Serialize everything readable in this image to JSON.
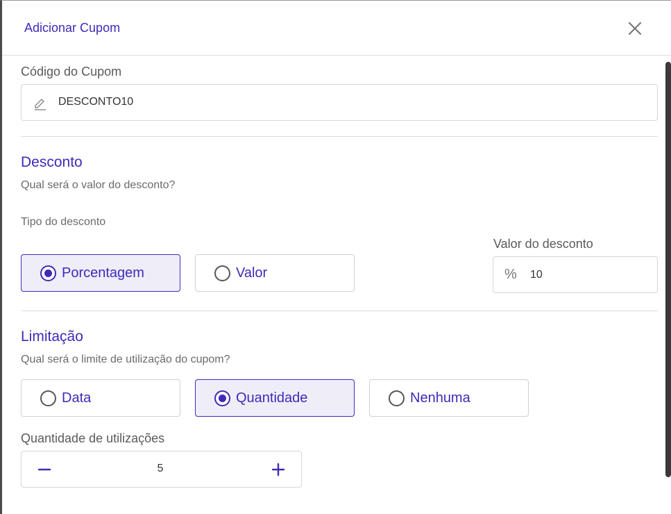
{
  "modal": {
    "title": "Adicionar Cupom",
    "close_icon": "close-icon"
  },
  "coupon_code": {
    "label": "Código do Cupom",
    "value": "DESCONTO10",
    "icon": "edit-pencil-icon"
  },
  "discount": {
    "title": "Desconto",
    "subtitle": "Qual será o valor do desconto?",
    "type_label": "Tipo do desconto",
    "options": [
      {
        "label": "Porcentagem",
        "selected": true
      },
      {
        "label": "Valor",
        "selected": false
      }
    ],
    "value_label": "Valor do desconto",
    "value_icon": "percent-icon",
    "value_symbol": "%",
    "value": "10"
  },
  "limitation": {
    "title": "Limitação",
    "subtitle": "Qual será o limite de utilização do cupom?",
    "options": [
      {
        "label": "Data",
        "selected": false
      },
      {
        "label": "Quantidade",
        "selected": true
      },
      {
        "label": "Nenhuma",
        "selected": false
      }
    ],
    "quantity_label": "Quantidade de utilizações",
    "quantity_value": "5"
  },
  "colors": {
    "accent": "#3d2bb8",
    "selected_bg": "#efedf8",
    "border": "#d6d6d6"
  }
}
